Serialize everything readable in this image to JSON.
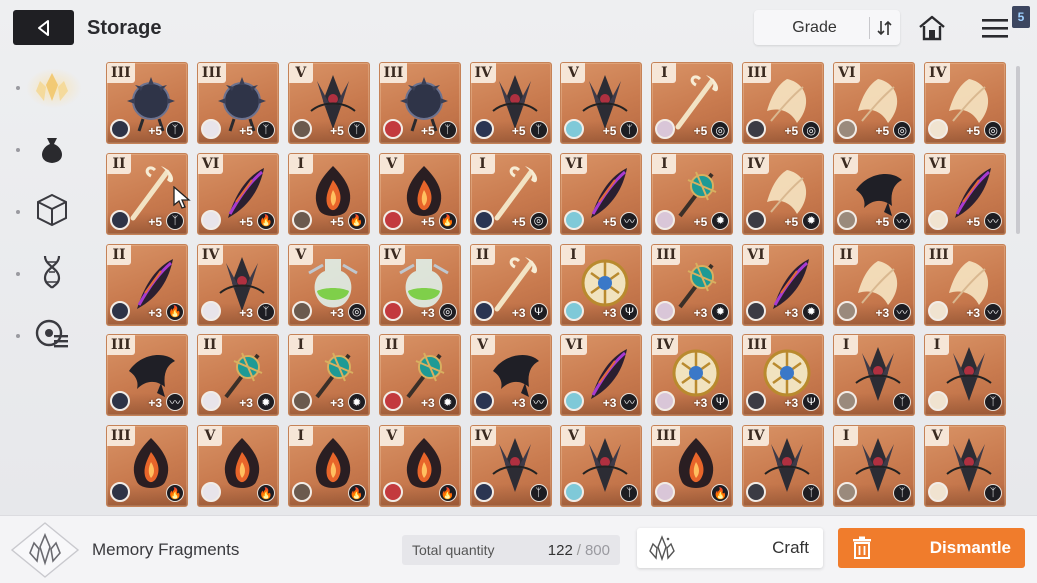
{
  "header": {
    "title": "Storage",
    "sort_label": "Grade",
    "menu_badge": "5"
  },
  "sidebar": {
    "items": [
      {
        "icon": "memory-fragment-icon",
        "active": true
      },
      {
        "icon": "pouch-icon",
        "active": false
      },
      {
        "icon": "cube-icon",
        "active": false
      },
      {
        "icon": "dna-icon",
        "active": false
      },
      {
        "icon": "disc-list-icon",
        "active": false
      }
    ]
  },
  "grid": {
    "tiles": [
      {
        "grade": "III",
        "enh": "+5",
        "elem": "ᛉ",
        "art": "mace"
      },
      {
        "grade": "III",
        "enh": "+5",
        "elem": "ᛉ",
        "art": "mace"
      },
      {
        "grade": "V",
        "enh": "+5",
        "elem": "ᛉ",
        "art": "claw"
      },
      {
        "grade": "III",
        "enh": "+5",
        "elem": "ᛉ",
        "art": "mace"
      },
      {
        "grade": "IV",
        "enh": "+5",
        "elem": "ᛉ",
        "art": "claw"
      },
      {
        "grade": "V",
        "enh": "+5",
        "elem": "ᛉ",
        "art": "claw"
      },
      {
        "grade": "I",
        "enh": "+5",
        "elem": "◎",
        "art": "staff"
      },
      {
        "grade": "III",
        "enh": "+5",
        "elem": "◎",
        "art": "feather"
      },
      {
        "grade": "VI",
        "enh": "+5",
        "elem": "◎",
        "art": "feather"
      },
      {
        "grade": "IV",
        "enh": "+5",
        "elem": "◎",
        "art": "feather"
      },
      {
        "grade": "II",
        "enh": "+5",
        "elem": "ᛉ",
        "art": "staff"
      },
      {
        "grade": "VI",
        "enh": "+5",
        "elem": "🔥",
        "art": "plume"
      },
      {
        "grade": "I",
        "enh": "+5",
        "elem": "🔥",
        "art": "flame"
      },
      {
        "grade": "V",
        "enh": "+5",
        "elem": "🔥",
        "art": "flame"
      },
      {
        "grade": "I",
        "enh": "+5",
        "elem": "◎",
        "art": "staff"
      },
      {
        "grade": "VI",
        "enh": "+5",
        "elem": "〰",
        "art": "plume"
      },
      {
        "grade": "I",
        "enh": "+5",
        "elem": "✹",
        "art": "orb"
      },
      {
        "grade": "IV",
        "enh": "+5",
        "elem": "✹",
        "art": "feather"
      },
      {
        "grade": "V",
        "enh": "+5",
        "elem": "〰",
        "art": "crow"
      },
      {
        "grade": "VI",
        "enh": "+5",
        "elem": "〰",
        "art": "plume"
      },
      {
        "grade": "II",
        "enh": "+3",
        "elem": "🔥",
        "art": "plume"
      },
      {
        "grade": "IV",
        "enh": "+3",
        "elem": "ᛉ",
        "art": "claw"
      },
      {
        "grade": "V",
        "enh": "+3",
        "elem": "◎",
        "art": "potion"
      },
      {
        "grade": "IV",
        "enh": "+3",
        "elem": "◎",
        "art": "potion"
      },
      {
        "grade": "II",
        "enh": "+3",
        "elem": "Ψ",
        "art": "staff"
      },
      {
        "grade": "I",
        "enh": "+3",
        "elem": "Ψ",
        "art": "gold"
      },
      {
        "grade": "III",
        "enh": "+3",
        "elem": "✹",
        "art": "orb"
      },
      {
        "grade": "VI",
        "enh": "+3",
        "elem": "✹",
        "art": "plume"
      },
      {
        "grade": "II",
        "enh": "+3",
        "elem": "〰",
        "art": "feather"
      },
      {
        "grade": "III",
        "enh": "+3",
        "elem": "〰",
        "art": "feather"
      },
      {
        "grade": "III",
        "enh": "+3",
        "elem": "〰",
        "art": "crow"
      },
      {
        "grade": "II",
        "enh": "+3",
        "elem": "✹",
        "art": "orb"
      },
      {
        "grade": "I",
        "enh": "+3",
        "elem": "✹",
        "art": "orb"
      },
      {
        "grade": "II",
        "enh": "+3",
        "elem": "✹",
        "art": "orb"
      },
      {
        "grade": "V",
        "enh": "+3",
        "elem": "〰",
        "art": "crow"
      },
      {
        "grade": "VI",
        "enh": "+3",
        "elem": "〰",
        "art": "plume"
      },
      {
        "grade": "IV",
        "enh": "+3",
        "elem": "Ψ",
        "art": "gold"
      },
      {
        "grade": "III",
        "enh": "+3",
        "elem": "Ψ",
        "art": "gold"
      },
      {
        "grade": "I",
        "enh": "",
        "elem": "ᛉ",
        "art": "claw"
      },
      {
        "grade": "I",
        "enh": "",
        "elem": "ᛉ",
        "art": "claw"
      },
      {
        "grade": "III",
        "enh": "",
        "elem": "🔥",
        "art": "flame"
      },
      {
        "grade": "V",
        "enh": "",
        "elem": "🔥",
        "art": "flame"
      },
      {
        "grade": "I",
        "enh": "",
        "elem": "🔥",
        "art": "flame"
      },
      {
        "grade": "V",
        "enh": "",
        "elem": "🔥",
        "art": "flame"
      },
      {
        "grade": "IV",
        "enh": "",
        "elem": "ᛉ",
        "art": "claw"
      },
      {
        "grade": "V",
        "enh": "",
        "elem": "ᛉ",
        "art": "claw"
      },
      {
        "grade": "III",
        "enh": "",
        "elem": "🔥",
        "art": "flame"
      },
      {
        "grade": "IV",
        "enh": "",
        "elem": "ᛉ",
        "art": "claw"
      },
      {
        "grade": "I",
        "enh": "",
        "elem": "ᛉ",
        "art": "claw"
      },
      {
        "grade": "V",
        "enh": "",
        "elem": "ᛉ",
        "art": "claw"
      }
    ]
  },
  "footer": {
    "category_label": "Memory Fragments",
    "total_quantity_label": "Total quantity",
    "current_quantity": "122",
    "separator": "/",
    "max_quantity": "800",
    "craft_label": "Craft",
    "dismantle_label": "Dismantle"
  },
  "colors": {
    "accent": "#f07c2c",
    "tile_bg": "#c97b4f"
  }
}
